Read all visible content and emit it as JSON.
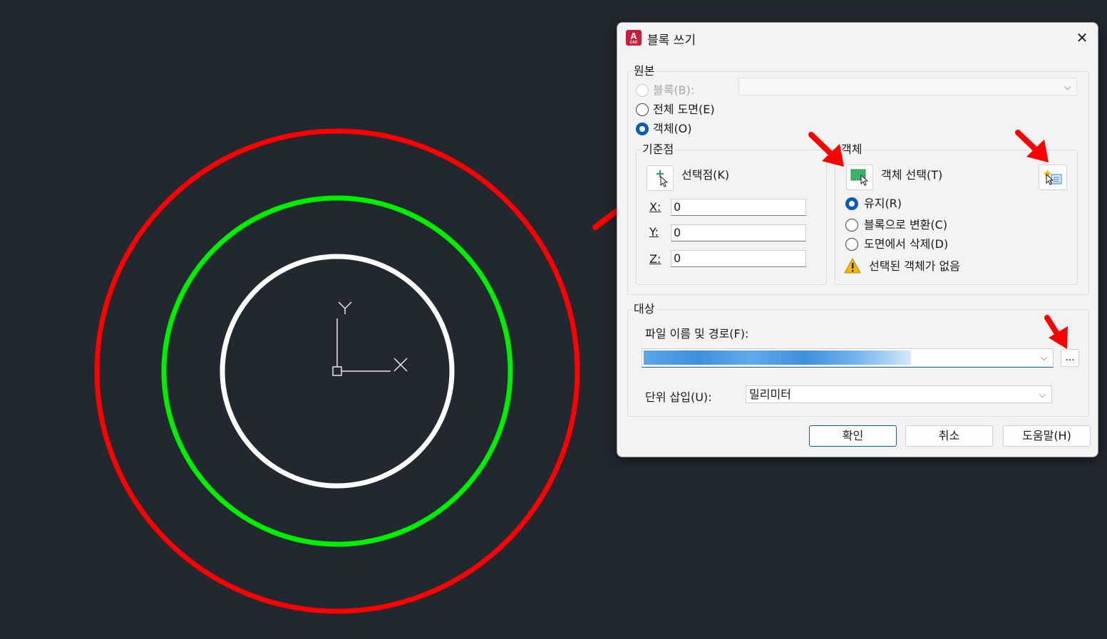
{
  "dialog": {
    "title": "블록 쓰기",
    "close_glyph": "✕",
    "app_icon_letter": "A",
    "app_icon_caption": "CAD"
  },
  "source": {
    "group_label": "원본",
    "radio_block_label": "블록(B):",
    "radio_entire_drawing_label": "전체 도면(E)",
    "radio_objects_label": "객체(O)",
    "selected": "objects",
    "block_dropdown_value": ""
  },
  "base_point": {
    "group_label": "기준점",
    "pick_point_label": "선택점(K)",
    "x_label": "X:",
    "x_value": "0",
    "y_label": "Y:",
    "y_value": "0",
    "z_label": "Z:",
    "z_value": "0"
  },
  "objects": {
    "group_label": "객체",
    "select_objects_label": "객체 선택(T)",
    "retain_label": "유지(R)",
    "convert_label": "블록으로 변환(C)",
    "delete_label": "도면에서 삭제(D)",
    "selected": "retain",
    "warning_text": "선택된 객체가 없음"
  },
  "destination": {
    "group_label": "대상",
    "file_path_label": "파일 이름 및 경로(F):",
    "file_path_value": "",
    "browse_label": "...",
    "units_label": "단위 삽입(U):",
    "units_value": "밀리미터"
  },
  "buttons": {
    "ok": "확인",
    "cancel": "취소",
    "help": "도움말(H)"
  },
  "canvas": {
    "ucs_x_label": "X",
    "ucs_y_label": "Y",
    "circle_colors": [
      "#ff0000",
      "#00ee00",
      "#ffffff"
    ],
    "background": "#212830",
    "annotation_arrow_color": "#ff0000"
  }
}
